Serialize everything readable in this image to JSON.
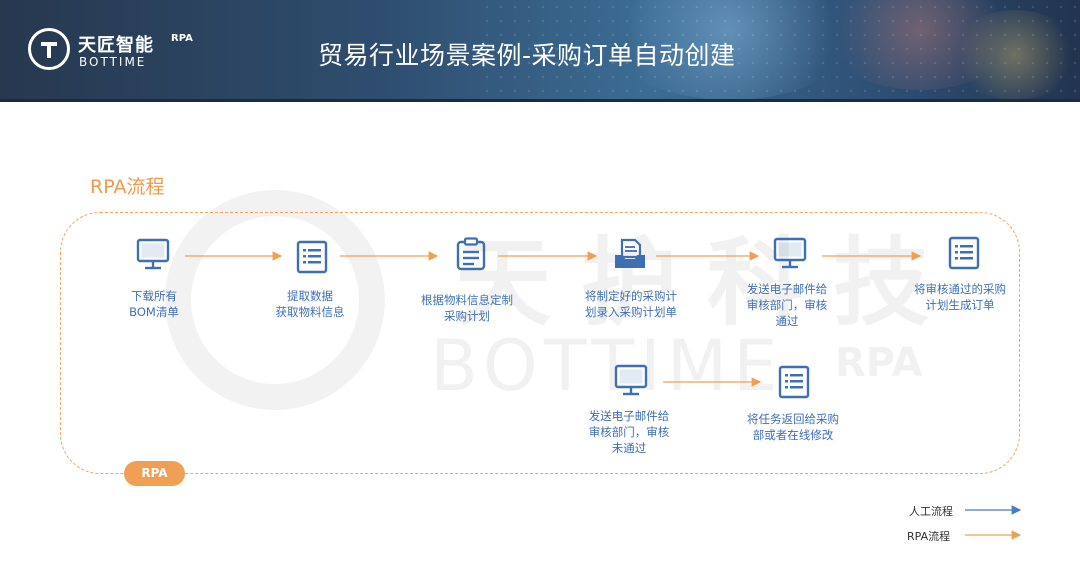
{
  "header": {
    "logo_cn": "天匠智能",
    "logo_rpa": "RPA",
    "logo_en": "BOTTIME",
    "title": "贸易行业场景案例-采购订单自动创建"
  },
  "section_label": "RPA流程",
  "frame_badge": "RPA",
  "watermark": {
    "cn": "天护科技",
    "en": "BOTTIME",
    "rpa": "RPA"
  },
  "nodes": [
    {
      "id": "n1",
      "icon": "monitor-icon",
      "label": "下载所有\nBOM清单"
    },
    {
      "id": "n2",
      "icon": "list-icon",
      "label": "提取数据\n获取物料信息"
    },
    {
      "id": "n3",
      "icon": "clipboard-icon",
      "label": "根据物料信息定制\n采购计划"
    },
    {
      "id": "n4",
      "icon": "inbox-document-icon",
      "label": "将制定好的采购计\n划录入采购计划单"
    },
    {
      "id": "n5",
      "icon": "monitor-icon",
      "label": "发送电子邮件给\n审核部门，审核\n通过"
    },
    {
      "id": "n6",
      "icon": "list-icon",
      "label": "将审核通过的采购\n计划生成订单"
    },
    {
      "id": "n7",
      "icon": "monitor-icon",
      "label": "发送电子邮件给\n审核部门，审核\n未通过"
    },
    {
      "id": "n8",
      "icon": "list-icon",
      "label": "将任务返回给采购\n部或者在线修改"
    }
  ],
  "legend": [
    {
      "label": "人工流程",
      "color": "#4a7bc4"
    },
    {
      "label": "RPA流程",
      "color": "#f0a055"
    }
  ],
  "colors": {
    "icon_blue": "#3f6fb3",
    "rpa_orange": "#f0a055",
    "label_orange": "#ee9c4c"
  }
}
